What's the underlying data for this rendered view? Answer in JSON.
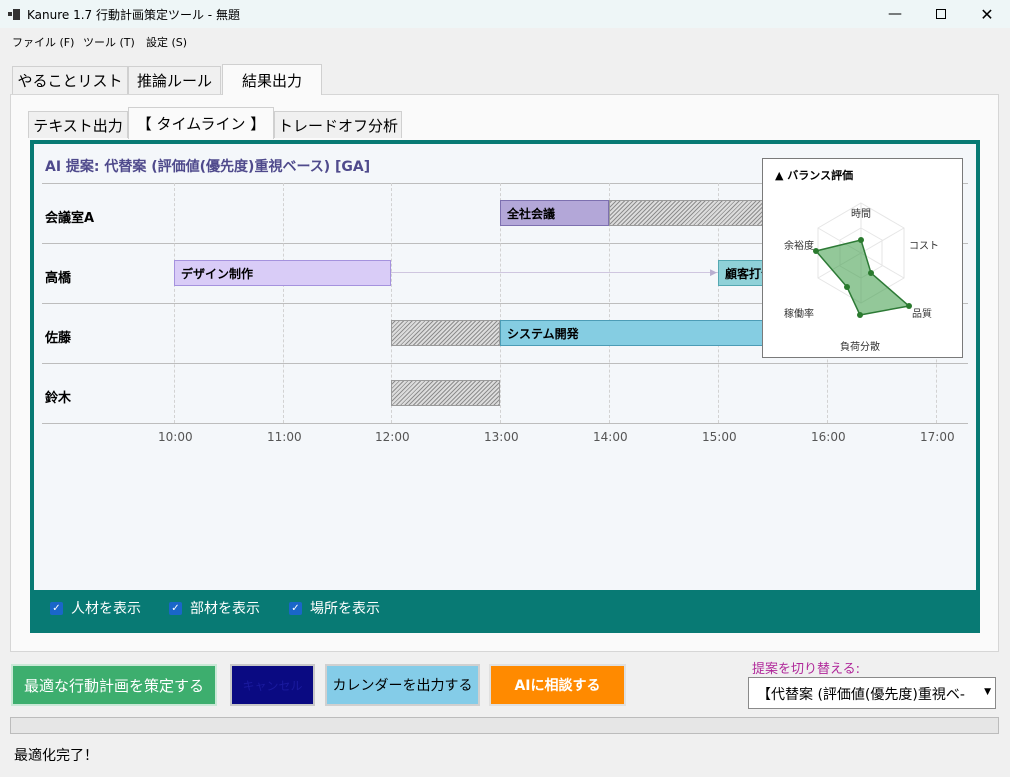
{
  "window": {
    "title": "Kanure 1.7  行動計画策定ツール - 無題"
  },
  "menu": [
    {
      "label": "ファイル (F)"
    },
    {
      "label": "ツール (T)"
    },
    {
      "label": "設定 (S)"
    }
  ],
  "main_tabs": [
    {
      "label": "やることリスト"
    },
    {
      "label": "推論ルール"
    },
    {
      "label": "結果出力"
    }
  ],
  "sub_tabs": [
    {
      "label": "テキスト出力"
    },
    {
      "label": "【 タイムライン 】"
    },
    {
      "label": "トレードオフ分析"
    }
  ],
  "timeline": {
    "title": "AI 提案: 代替案 (評価値(優先度)重視ベース) [GA]",
    "rows": [
      {
        "label": "会議室A"
      },
      {
        "label": "高橋"
      },
      {
        "label": "佐藤"
      },
      {
        "label": "鈴木"
      }
    ],
    "ticks": [
      "10:00",
      "11:00",
      "12:00",
      "13:00",
      "14:00",
      "15:00",
      "16:00",
      "17:00"
    ],
    "tasks": [
      {
        "label": "全社会議",
        "row": "会議室A",
        "start": "13:00",
        "end": "14:00",
        "color": "#b3a7d8"
      },
      {
        "label": "デザイン制作",
        "row": "高橋",
        "start": "10:00",
        "end": "12:00",
        "color": "#d9ccf7"
      },
      {
        "label": "顧客打合せ",
        "row": "高橋",
        "start": "15:00",
        "end": "16:00",
        "color": "#8fd1d8"
      },
      {
        "label": "システム開発",
        "row": "佐藤",
        "start": "13:00",
        "end": "16:00",
        "color": "#85cde2"
      }
    ],
    "unavailable": [
      {
        "row": "会議室A",
        "start": "14:00",
        "end": "16:00"
      },
      {
        "row": "佐藤",
        "start": "12:00",
        "end": "13:00"
      },
      {
        "row": "鈴木",
        "start": "12:00",
        "end": "13:00"
      }
    ]
  },
  "radar": {
    "title": "▲ バランス評価",
    "axes": [
      "時間",
      "コスト",
      "品質",
      "負荷分散",
      "稼働率",
      "余裕度"
    ],
    "color": "#3a9a46"
  },
  "display_options": [
    {
      "label": "人材を表示",
      "checked": true
    },
    {
      "label": "部材を表示",
      "checked": true
    },
    {
      "label": "場所を表示",
      "checked": true
    }
  ],
  "buttons": {
    "optimize": "最適な行動計画を策定する",
    "cancel": "キャンセル",
    "export_calendar": "カレンダーを出力する",
    "consult_ai": "AIに相談する"
  },
  "proposal": {
    "label": "提案を切り替える:",
    "selected": "【代替案 (評価値(優先度)重視ベ-"
  },
  "status": {
    "text": "最適化完了！"
  }
}
